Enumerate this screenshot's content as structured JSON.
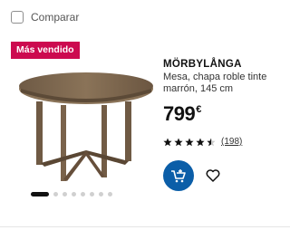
{
  "compare": {
    "label": "Comparar",
    "checked": false
  },
  "badge": {
    "label": "Más vendido",
    "color": "#cc0a4f"
  },
  "product": {
    "name": "MÖRBYLÅNGA",
    "description": "Mesa, chapa roble tinte marrón, 145 cm",
    "price": "799",
    "currency": "€",
    "rating": {
      "stars": 4.5,
      "max": 5,
      "count": "(198)"
    },
    "image_icon": "round-table-image"
  },
  "actions": {
    "add_to_cart_icon": "cart-add-icon",
    "favorite_icon": "heart-icon",
    "accent": "#0b5ea8"
  },
  "carousel": {
    "total": 8,
    "active": 1
  }
}
